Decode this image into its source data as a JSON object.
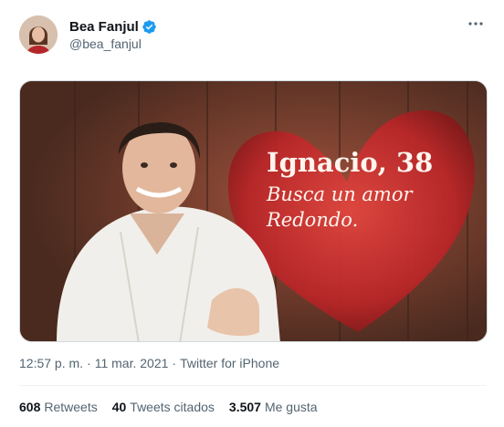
{
  "author": {
    "name": "Bea Fanjul",
    "handle": "@bea_fanjul",
    "verified": true
  },
  "media": {
    "title": "Ignacio, 38",
    "line1": "Busca un amor",
    "line2": "Redondo."
  },
  "meta": {
    "time": "12:57 p. m.",
    "separator": "·",
    "date": "11 mar. 2021",
    "source": "Twitter for iPhone"
  },
  "stats": {
    "retweets_count": "608",
    "retweets_label": "Retweets",
    "quotes_count": "40",
    "quotes_label": "Tweets citados",
    "likes_count": "3.507",
    "likes_label": "Me gusta"
  },
  "colors": {
    "verified": "#1d9bf0",
    "secondary_text": "#536471",
    "heart": "#c0272d"
  },
  "icons": [
    "verified-badge-icon",
    "more-options-icon"
  ]
}
